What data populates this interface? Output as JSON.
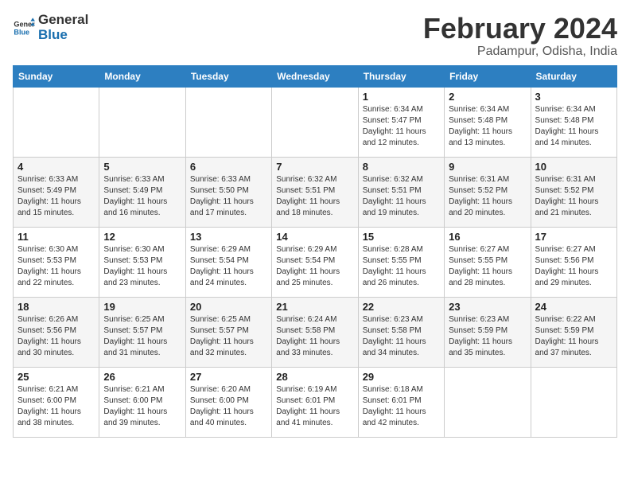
{
  "header": {
    "logo_general": "General",
    "logo_blue": "Blue",
    "month_title": "February 2024",
    "location": "Padampur, Odisha, India"
  },
  "weekdays": [
    "Sunday",
    "Monday",
    "Tuesday",
    "Wednesday",
    "Thursday",
    "Friday",
    "Saturday"
  ],
  "weeks": [
    [
      {
        "day": "",
        "sunrise": "",
        "sunset": "",
        "daylight": ""
      },
      {
        "day": "",
        "sunrise": "",
        "sunset": "",
        "daylight": ""
      },
      {
        "day": "",
        "sunrise": "",
        "sunset": "",
        "daylight": ""
      },
      {
        "day": "",
        "sunrise": "",
        "sunset": "",
        "daylight": ""
      },
      {
        "day": "1",
        "sunrise": "Sunrise: 6:34 AM",
        "sunset": "Sunset: 5:47 PM",
        "daylight": "Daylight: 11 hours and 12 minutes."
      },
      {
        "day": "2",
        "sunrise": "Sunrise: 6:34 AM",
        "sunset": "Sunset: 5:48 PM",
        "daylight": "Daylight: 11 hours and 13 minutes."
      },
      {
        "day": "3",
        "sunrise": "Sunrise: 6:34 AM",
        "sunset": "Sunset: 5:48 PM",
        "daylight": "Daylight: 11 hours and 14 minutes."
      }
    ],
    [
      {
        "day": "4",
        "sunrise": "Sunrise: 6:33 AM",
        "sunset": "Sunset: 5:49 PM",
        "daylight": "Daylight: 11 hours and 15 minutes."
      },
      {
        "day": "5",
        "sunrise": "Sunrise: 6:33 AM",
        "sunset": "Sunset: 5:49 PM",
        "daylight": "Daylight: 11 hours and 16 minutes."
      },
      {
        "day": "6",
        "sunrise": "Sunrise: 6:33 AM",
        "sunset": "Sunset: 5:50 PM",
        "daylight": "Daylight: 11 hours and 17 minutes."
      },
      {
        "day": "7",
        "sunrise": "Sunrise: 6:32 AM",
        "sunset": "Sunset: 5:51 PM",
        "daylight": "Daylight: 11 hours and 18 minutes."
      },
      {
        "day": "8",
        "sunrise": "Sunrise: 6:32 AM",
        "sunset": "Sunset: 5:51 PM",
        "daylight": "Daylight: 11 hours and 19 minutes."
      },
      {
        "day": "9",
        "sunrise": "Sunrise: 6:31 AM",
        "sunset": "Sunset: 5:52 PM",
        "daylight": "Daylight: 11 hours and 20 minutes."
      },
      {
        "day": "10",
        "sunrise": "Sunrise: 6:31 AM",
        "sunset": "Sunset: 5:52 PM",
        "daylight": "Daylight: 11 hours and 21 minutes."
      }
    ],
    [
      {
        "day": "11",
        "sunrise": "Sunrise: 6:30 AM",
        "sunset": "Sunset: 5:53 PM",
        "daylight": "Daylight: 11 hours and 22 minutes."
      },
      {
        "day": "12",
        "sunrise": "Sunrise: 6:30 AM",
        "sunset": "Sunset: 5:53 PM",
        "daylight": "Daylight: 11 hours and 23 minutes."
      },
      {
        "day": "13",
        "sunrise": "Sunrise: 6:29 AM",
        "sunset": "Sunset: 5:54 PM",
        "daylight": "Daylight: 11 hours and 24 minutes."
      },
      {
        "day": "14",
        "sunrise": "Sunrise: 6:29 AM",
        "sunset": "Sunset: 5:54 PM",
        "daylight": "Daylight: 11 hours and 25 minutes."
      },
      {
        "day": "15",
        "sunrise": "Sunrise: 6:28 AM",
        "sunset": "Sunset: 5:55 PM",
        "daylight": "Daylight: 11 hours and 26 minutes."
      },
      {
        "day": "16",
        "sunrise": "Sunrise: 6:27 AM",
        "sunset": "Sunset: 5:55 PM",
        "daylight": "Daylight: 11 hours and 28 minutes."
      },
      {
        "day": "17",
        "sunrise": "Sunrise: 6:27 AM",
        "sunset": "Sunset: 5:56 PM",
        "daylight": "Daylight: 11 hours and 29 minutes."
      }
    ],
    [
      {
        "day": "18",
        "sunrise": "Sunrise: 6:26 AM",
        "sunset": "Sunset: 5:56 PM",
        "daylight": "Daylight: 11 hours and 30 minutes."
      },
      {
        "day": "19",
        "sunrise": "Sunrise: 6:25 AM",
        "sunset": "Sunset: 5:57 PM",
        "daylight": "Daylight: 11 hours and 31 minutes."
      },
      {
        "day": "20",
        "sunrise": "Sunrise: 6:25 AM",
        "sunset": "Sunset: 5:57 PM",
        "daylight": "Daylight: 11 hours and 32 minutes."
      },
      {
        "day": "21",
        "sunrise": "Sunrise: 6:24 AM",
        "sunset": "Sunset: 5:58 PM",
        "daylight": "Daylight: 11 hours and 33 minutes."
      },
      {
        "day": "22",
        "sunrise": "Sunrise: 6:23 AM",
        "sunset": "Sunset: 5:58 PM",
        "daylight": "Daylight: 11 hours and 34 minutes."
      },
      {
        "day": "23",
        "sunrise": "Sunrise: 6:23 AM",
        "sunset": "Sunset: 5:59 PM",
        "daylight": "Daylight: 11 hours and 35 minutes."
      },
      {
        "day": "24",
        "sunrise": "Sunrise: 6:22 AM",
        "sunset": "Sunset: 5:59 PM",
        "daylight": "Daylight: 11 hours and 37 minutes."
      }
    ],
    [
      {
        "day": "25",
        "sunrise": "Sunrise: 6:21 AM",
        "sunset": "Sunset: 6:00 PM",
        "daylight": "Daylight: 11 hours and 38 minutes."
      },
      {
        "day": "26",
        "sunrise": "Sunrise: 6:21 AM",
        "sunset": "Sunset: 6:00 PM",
        "daylight": "Daylight: 11 hours and 39 minutes."
      },
      {
        "day": "27",
        "sunrise": "Sunrise: 6:20 AM",
        "sunset": "Sunset: 6:00 PM",
        "daylight": "Daylight: 11 hours and 40 minutes."
      },
      {
        "day": "28",
        "sunrise": "Sunrise: 6:19 AM",
        "sunset": "Sunset: 6:01 PM",
        "daylight": "Daylight: 11 hours and 41 minutes."
      },
      {
        "day": "29",
        "sunrise": "Sunrise: 6:18 AM",
        "sunset": "Sunset: 6:01 PM",
        "daylight": "Daylight: 11 hours and 42 minutes."
      },
      {
        "day": "",
        "sunrise": "",
        "sunset": "",
        "daylight": ""
      },
      {
        "day": "",
        "sunrise": "",
        "sunset": "",
        "daylight": ""
      }
    ]
  ]
}
